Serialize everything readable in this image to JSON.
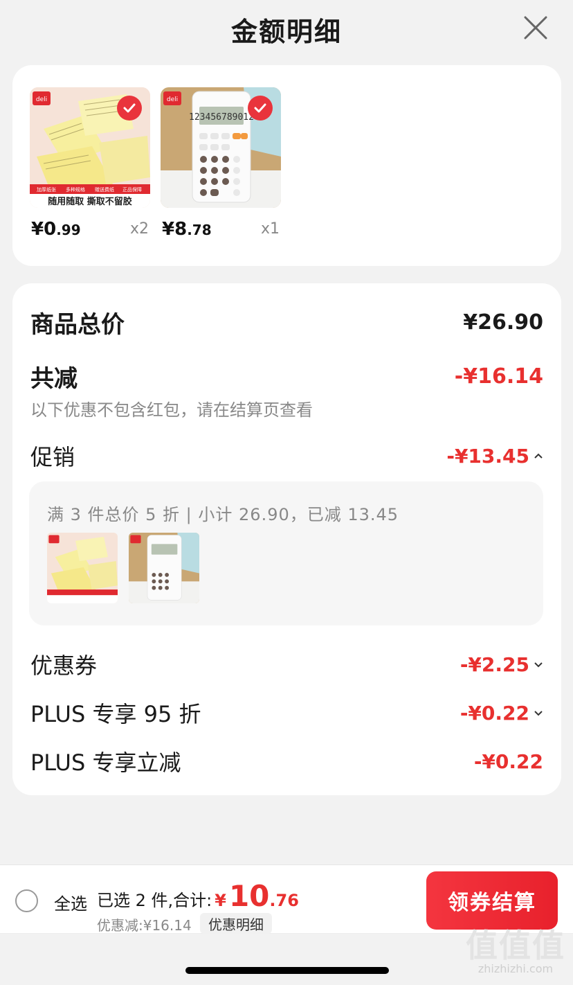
{
  "header": {
    "title": "金额明细"
  },
  "products": [
    {
      "price_int": "¥0",
      "price_dec": ".99",
      "qty": "x2",
      "caption": "随用随取 撕取不留胶",
      "brand": "deli"
    },
    {
      "price_int": "¥8",
      "price_dec": ".78",
      "qty": "x1",
      "brand": "deli"
    }
  ],
  "details": {
    "total_label": "商品总价",
    "total_value": "¥26.90",
    "reduce_label": "共减",
    "reduce_value": "-¥16.14",
    "reduce_note": "以下优惠不包含红包，请在结算页查看",
    "promo_label": "促销",
    "promo_value": "-¥13.45",
    "promo_desc": "满 3 件总价 5 折 | 小计 26.90，已减 13.45",
    "coupon_label": "优惠券",
    "coupon_value": "-¥2.25",
    "plus95_label": "PLUS 专享 95 折",
    "plus95_value": "-¥0.22",
    "plus_reduce_label": "PLUS 专享立减",
    "plus_reduce_value": "-¥0.22"
  },
  "bottom": {
    "select_all": "全选",
    "selected_text": "已选 2 件,合计:",
    "total_symbol": "¥",
    "total_int": "10",
    "total_dec": ".76",
    "discount_text": "优惠减:¥16.14",
    "detail_chip": "优惠明细",
    "checkout": "领券结算"
  },
  "watermark": {
    "logo": "值值值",
    "url": "zhizhizhi.com"
  },
  "colors": {
    "accent": "#e8302f",
    "background": "#f2f2f2"
  }
}
